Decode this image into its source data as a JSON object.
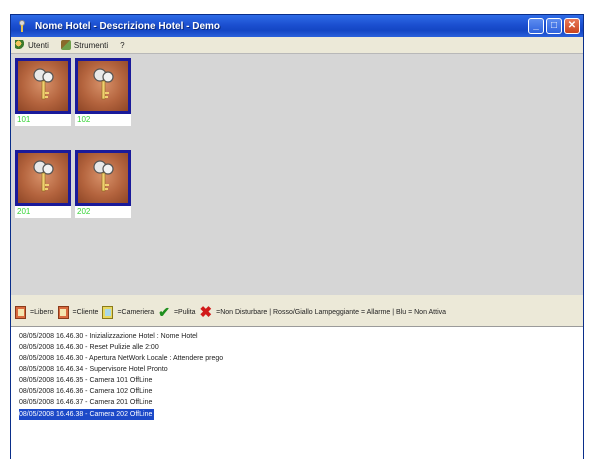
{
  "window": {
    "title": "Nome Hotel - Descrizione Hotel - Demo",
    "controls": {
      "minimize": "_",
      "maximize": "□",
      "close": "✕"
    }
  },
  "menu": {
    "items": [
      {
        "label": "Utenti",
        "icon": "users-icon"
      },
      {
        "label": "Strumenti",
        "icon": "tools-icon"
      },
      {
        "label": "?"
      }
    ]
  },
  "rooms": [
    {
      "number": "101",
      "icon": "room-key-icon"
    },
    {
      "number": "102",
      "icon": "room-key-icon"
    },
    {
      "number": "201",
      "icon": "room-key-icon"
    },
    {
      "number": "202",
      "icon": "room-key-icon"
    }
  ],
  "legend": {
    "libero": "=Libero",
    "cliente": "=Cliente",
    "cameriera": "=Cameriera",
    "pulita": "=Pulita",
    "non_disturbare": "=Non Disturbare | Rosso/Giallo Lampeggiante = Allarme | Blu = Non Attiva",
    "colors": {
      "status_ok": "#1f8f1f",
      "status_disturb": "#d11a1a",
      "room_free": "#36d436"
    }
  },
  "log": {
    "lines": [
      "08/05/2008 16.46.30 - Inizializzazione Hotel  : Nome Hotel",
      "08/05/2008 16.46.30 - Reset Pulizie alle 2:00",
      "08/05/2008 16.46.30 - Apertura NetWork Locale : Attendere prego",
      "08/05/2008 16.46.34 - Supervisore Hotel Pronto",
      "08/05/2008 16.46.35 - Camera 101 OffLine",
      "08/05/2008 16.46.36 - Camera 102 OffLine",
      "08/05/2008 16.46.37 - Camera 201 OffLine",
      "08/05/2008 16.46.38 - Camera 202 OffLine"
    ],
    "selected_index": 7
  }
}
